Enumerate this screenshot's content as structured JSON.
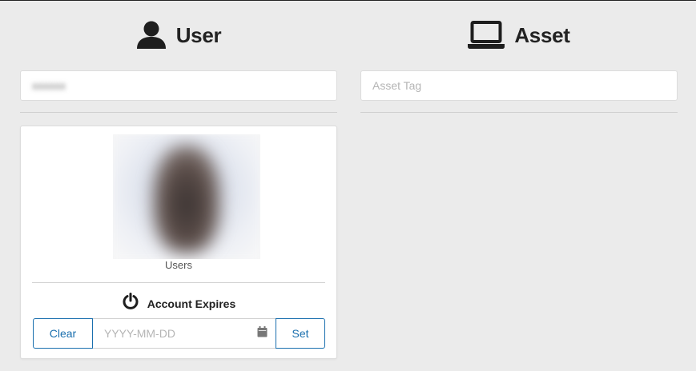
{
  "user_panel": {
    "title": "User",
    "icon": "user-icon",
    "search_value": "xxxxxx",
    "photo_caption": "Users",
    "account_expires": {
      "label": "Account Expires",
      "icon": "power-icon",
      "clear_label": "Clear",
      "date_placeholder": "YYYY-MM-DD",
      "date_value": "",
      "calendar_icon": "calendar-icon",
      "set_label": "Set"
    }
  },
  "asset_panel": {
    "title": "Asset",
    "icon": "laptop-icon",
    "search_placeholder": "Asset Tag",
    "search_value": ""
  },
  "colors": {
    "background": "#ebebeb",
    "accent": "#1a6fae",
    "text": "#222222"
  }
}
